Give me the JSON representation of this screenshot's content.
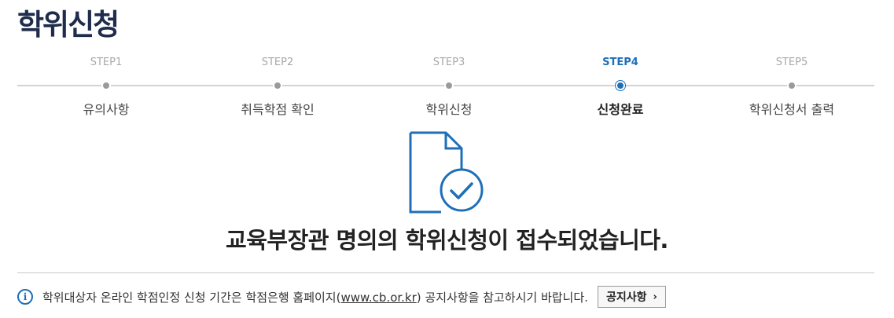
{
  "page": {
    "title": "학위신청"
  },
  "steps": [
    {
      "num": "STEP1",
      "label": "유의사항",
      "active": false
    },
    {
      "num": "STEP2",
      "label": "취득학점 확인",
      "active": false
    },
    {
      "num": "STEP3",
      "label": "학위신청",
      "active": false
    },
    {
      "num": "STEP4",
      "label": "신청완료",
      "active": true
    },
    {
      "num": "STEP5",
      "label": "학위신청서 출력",
      "active": false
    }
  ],
  "completion": {
    "icon": "document-check-icon",
    "message": "교육부장관 명의의 학위신청이 접수되었습니다."
  },
  "info": {
    "icon": "info-icon",
    "text_before": "학위대상자 온라인 학점인정 신청 기간은 학점은행 홈페이지(",
    "link": "www.cb.or.kr",
    "text_after": ") 공지사항을 참고하시기 바랍니다.",
    "button_label": "공지사항",
    "button_chevron": "›"
  },
  "colors": {
    "title": "#1f2c4c",
    "accent": "#1e6fb8",
    "inactive_step": "#a8a8a8"
  }
}
